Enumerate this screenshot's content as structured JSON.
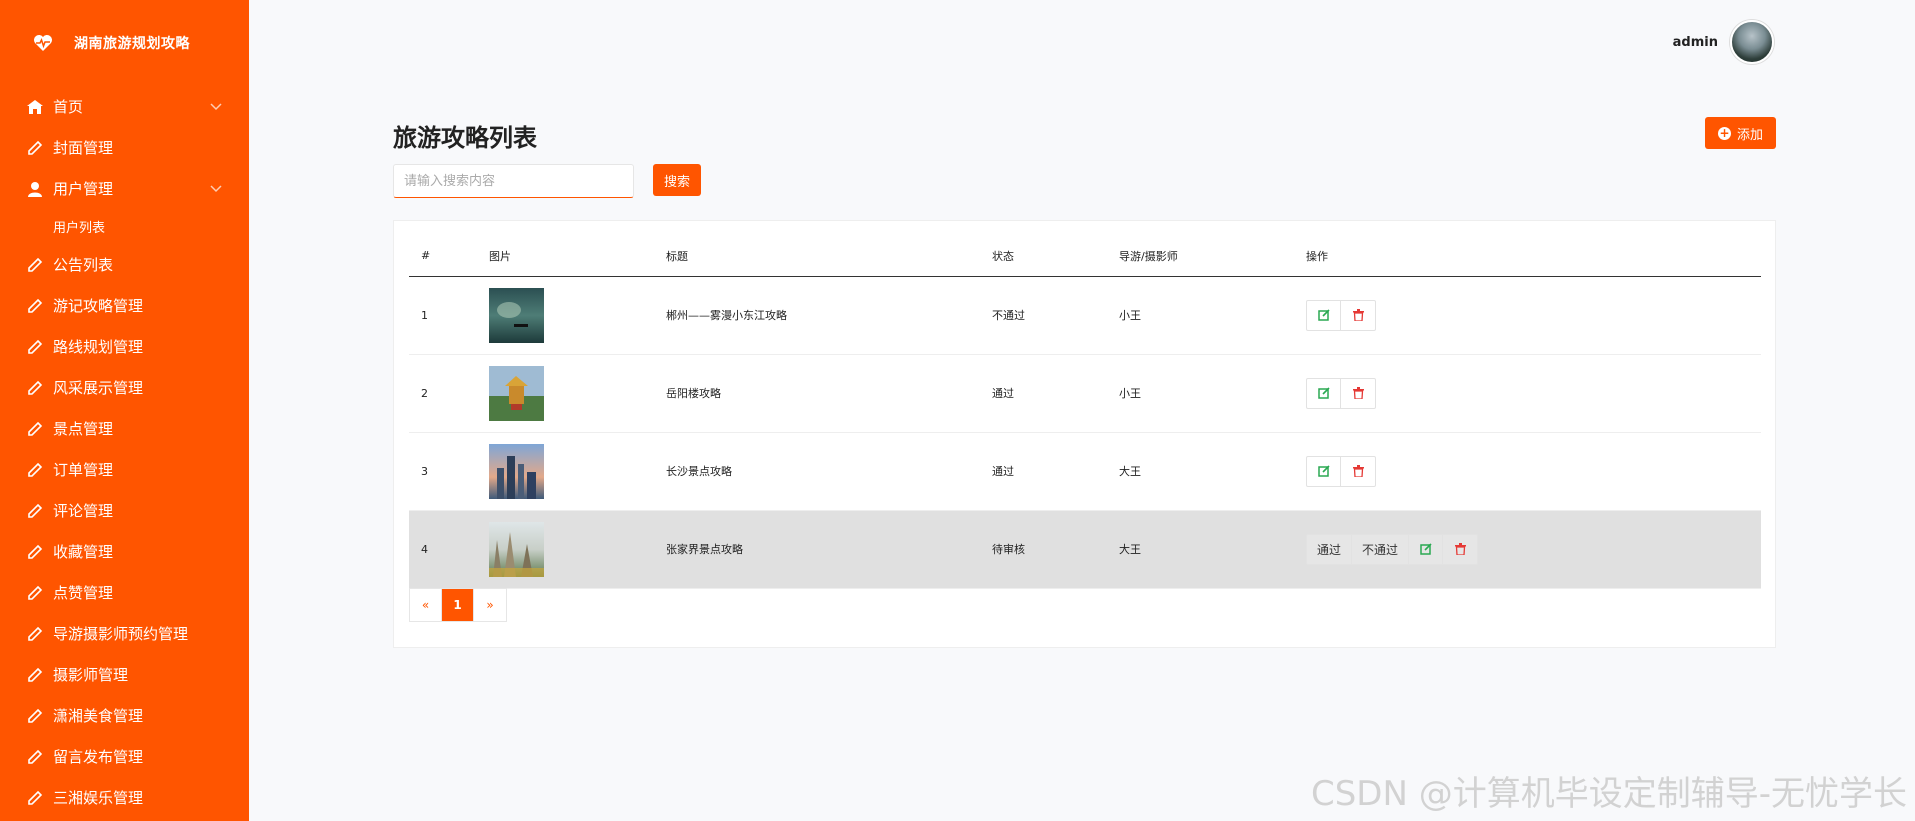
{
  "brand": {
    "title": "湖南旅游规划攻略",
    "logo_icon": "heart-pulse-icon"
  },
  "sidebar": {
    "items": [
      {
        "label": "首页",
        "icon": "home-icon",
        "expandable": true
      },
      {
        "label": "封面管理",
        "icon": "pencil-icon"
      },
      {
        "label": "用户管理",
        "icon": "user-icon",
        "expandable": true
      },
      {
        "label": "用户列表",
        "sub": true
      },
      {
        "label": "公告列表",
        "icon": "pencil-icon"
      },
      {
        "label": "游记攻略管理",
        "icon": "pencil-icon"
      },
      {
        "label": "路线规划管理",
        "icon": "pencil-icon"
      },
      {
        "label": "风采展示管理",
        "icon": "pencil-icon"
      },
      {
        "label": "景点管理",
        "icon": "pencil-icon"
      },
      {
        "label": "订单管理",
        "icon": "pencil-icon"
      },
      {
        "label": "评论管理",
        "icon": "pencil-icon"
      },
      {
        "label": "收藏管理",
        "icon": "pencil-icon"
      },
      {
        "label": "点赞管理",
        "icon": "pencil-icon"
      },
      {
        "label": "导游摄影师预约管理",
        "icon": "pencil-icon"
      },
      {
        "label": "摄影师管理",
        "icon": "pencil-icon"
      },
      {
        "label": "潇湘美食管理",
        "icon": "pencil-icon"
      },
      {
        "label": "留言发布管理",
        "icon": "pencil-icon"
      },
      {
        "label": "三湘娱乐管理",
        "icon": "pencil-icon"
      }
    ]
  },
  "header": {
    "username": "admin"
  },
  "main": {
    "title": "旅游攻略列表",
    "add_label": "添加",
    "search": {
      "placeholder": "请输入搜索内容",
      "value": "",
      "button_label": "搜索"
    },
    "table": {
      "columns": [
        "#",
        "图片",
        "标题",
        "状态",
        "导游/摄影师",
        "操作"
      ],
      "rows": [
        {
          "id": "1",
          "title": "郴州——雾漫小东江攻略",
          "status": "不通过",
          "guide": "小王",
          "pending": false
        },
        {
          "id": "2",
          "title": "岳阳楼攻略",
          "status": "通过",
          "guide": "小王",
          "pending": false
        },
        {
          "id": "3",
          "title": "长沙景点攻略",
          "status": "通过",
          "guide": "大王",
          "pending": false
        },
        {
          "id": "4",
          "title": "张家界景点攻略",
          "status": "待审核",
          "guide": "大王",
          "pending": true,
          "approve_label": "通过",
          "reject_label": "不通过"
        }
      ]
    },
    "pagination": {
      "prev": "«",
      "current": "1",
      "next": "»"
    }
  },
  "watermark": "CSDN @计算机毕设定制辅导-无忧学长",
  "colors": {
    "accent": "#ff5500",
    "edit": "#2aa952",
    "delete": "#e53935"
  }
}
